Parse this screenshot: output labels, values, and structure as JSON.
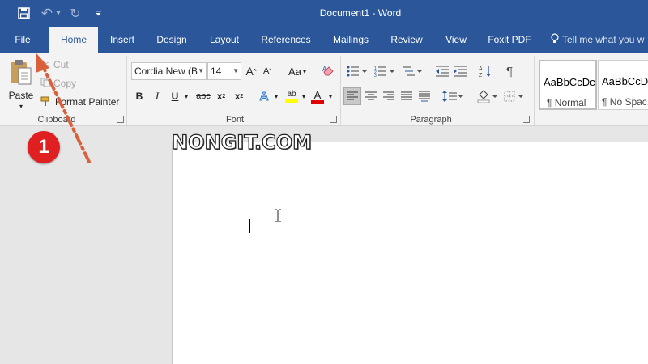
{
  "title_bar": {
    "document_title": "Document1 - Word",
    "qat": [
      {
        "name": "save-icon",
        "glyph": "💾"
      },
      {
        "name": "undo-icon",
        "glyph": "↶"
      },
      {
        "name": "undo-dropdown-icon",
        "glyph": "▾"
      },
      {
        "name": "redo-icon",
        "glyph": "↻"
      },
      {
        "name": "customize-qat-icon",
        "glyph": "⌄"
      }
    ]
  },
  "tabs": [
    "File",
    "Home",
    "Insert",
    "Design",
    "Layout",
    "References",
    "Mailings",
    "Review",
    "View",
    "Foxit PDF"
  ],
  "active_tab": "Home",
  "tell_me": {
    "icon": "lightbulb-icon",
    "text": "Tell me what you w"
  },
  "clipboard": {
    "paste_label": "Paste",
    "cut_label": "Cut",
    "copy_label": "Copy",
    "format_painter_label": "Format Painter",
    "group_label": "Clipboard"
  },
  "font": {
    "font_name": "Cordia New (B",
    "font_size": "14",
    "group_label": "Font",
    "grow_label": "A",
    "shrink_label": "A",
    "case_label": "Aa",
    "bold": "B",
    "italic": "I",
    "underline": "U",
    "strike": "abc",
    "subscript": "x",
    "superscript": "x",
    "sub_mark": "2",
    "sup_mark": "2",
    "highlight_label": "ab",
    "font_color_label": "A",
    "text_effect_label": "A"
  },
  "paragraph": {
    "group_label": "Paragraph",
    "show_marks": "¶"
  },
  "styles": [
    {
      "sample": "AaBbCcDc",
      "name": "¶ Normal"
    },
    {
      "sample": "AaBbCcDc",
      "name": "¶ No Spac..."
    }
  ],
  "watermark": "NONGIT.COM",
  "annotation": {
    "step_number": "1"
  },
  "colors": {
    "ribbon_blue": "#2b579a",
    "ribbon_bg": "#f3f3f3",
    "workspace": "#e6e6e6",
    "step_red": "#e02020",
    "arrow_color": "#d9603b",
    "highlight_yellow": "#ffff00",
    "font_red": "#e00000"
  }
}
